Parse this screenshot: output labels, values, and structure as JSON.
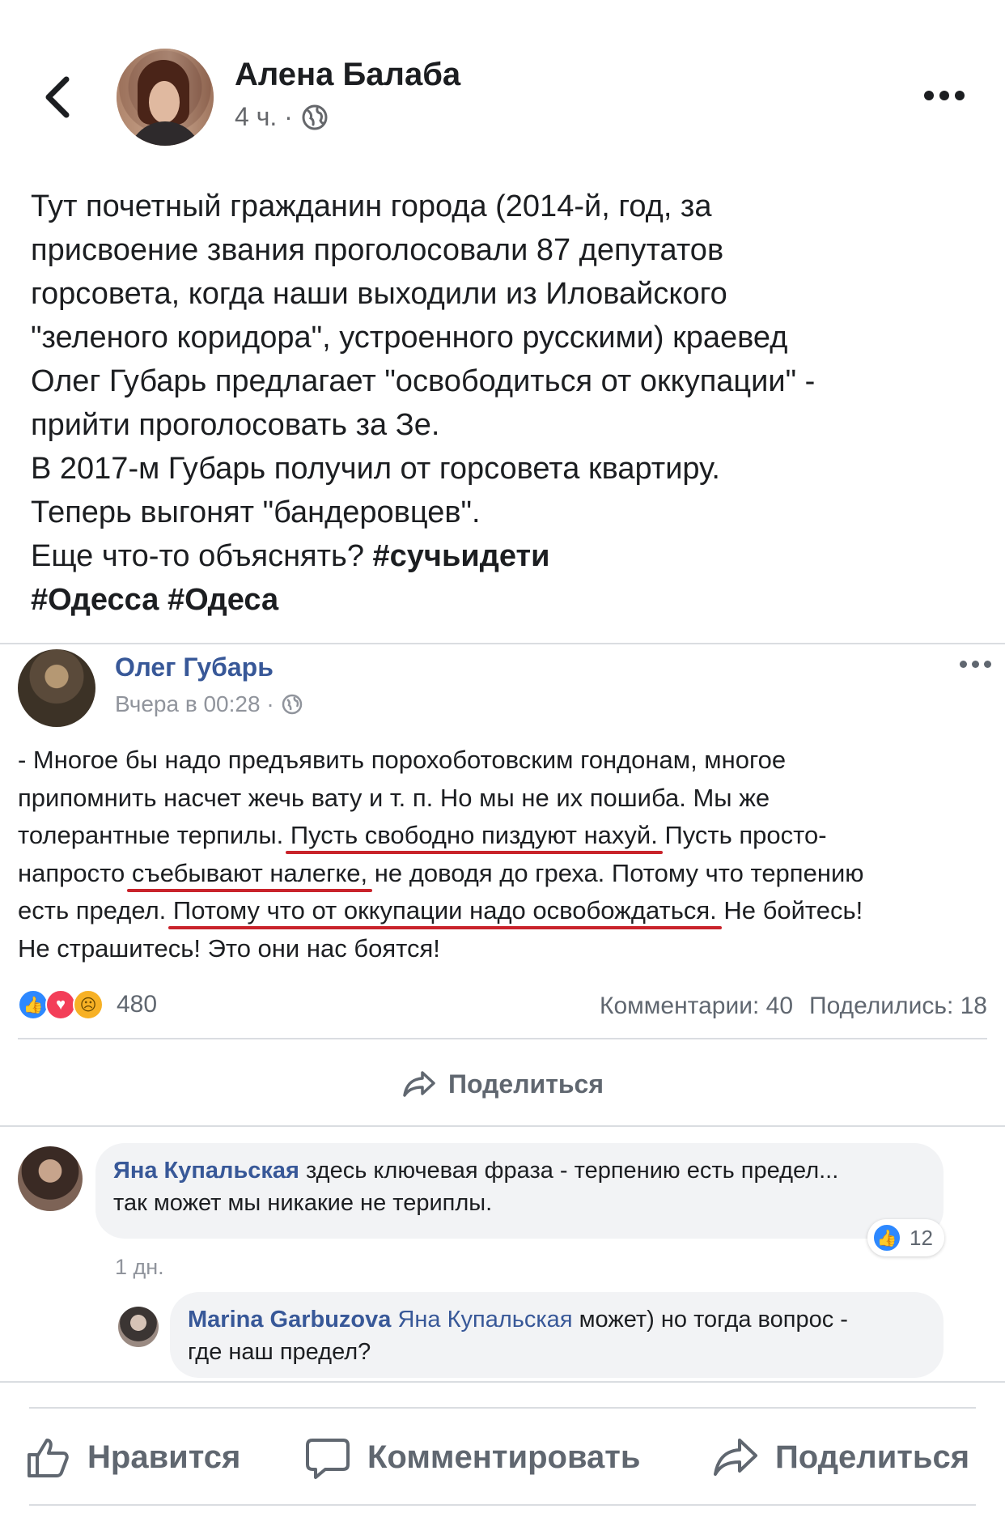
{
  "post": {
    "author": "Алена Балаба",
    "time": "4 ч. ·",
    "text_lines": [
      "Тут почетный гражданин города (2014-й, год, за",
      "присвоение звания проголосовали 87 депутатов",
      "горсовета, когда наши выходили из Иловайского",
      "\"зеленого коридора\", устроенного русскими) краевед",
      "Олег Губарь предлагает \"освободиться от оккупации\" -",
      "прийти проголосовать за Зе.",
      "В 2017-м Губарь получил от горсовета квартиру.",
      "Теперь выгонят \"бандеровцев\"."
    ],
    "line9_text": "Еще что-то объяснять? ",
    "hashtag1": "#сучьидети",
    "hashtag2": "#Одесса",
    "hashtag3": "#Одеса"
  },
  "embedded": {
    "author": "Олег Губарь",
    "time": "Вчера в 00:28 ·",
    "line1": "- Многое бы надо предъявить порохоботовским гондонам, многое",
    "line2": "припомнить насчет жечь вату и т. п. Но мы не их пошиба. Мы же",
    "line3a": "толерантные терпилы. ",
    "line3u": "Пусть свободно пиздуют нахуй.",
    "line3b": " Пусть просто-",
    "line4a": "напросто ",
    "line4u": "съебывают налегке,",
    "line4b": " не доводя до греха. Потому что терпению",
    "line5a": "есть предел. ",
    "line5u": "Потому что от оккупации надо освобождаться.",
    "line5b": " Не бойтесь!",
    "line6": "Не страшитесь! Это они нас боятся!",
    "reactions_count": "480",
    "comments": "Комментарии: 40",
    "shares": "Поделились: 18",
    "share_label": "Поделиться",
    "comment1": {
      "author": "Яна Купальская",
      "text_line1": " здесь ключевая фраза - терпению есть предел...",
      "text_line2": "так может мы никакие не териплы.",
      "time": "1 дн.",
      "likes": "12"
    },
    "comment2": {
      "author": "Marina Garbuzova",
      "mention": " Яна Купальская",
      "text_line1": " может) но тогда вопрос -",
      "text_line2": "где наш предел?"
    }
  },
  "actions": {
    "like": "Нравится",
    "comment": "Комментировать",
    "share": "Поделиться"
  },
  "colors": {
    "link": "#385898",
    "underline": "#c9232b",
    "like_blue": "#2d88ff"
  }
}
